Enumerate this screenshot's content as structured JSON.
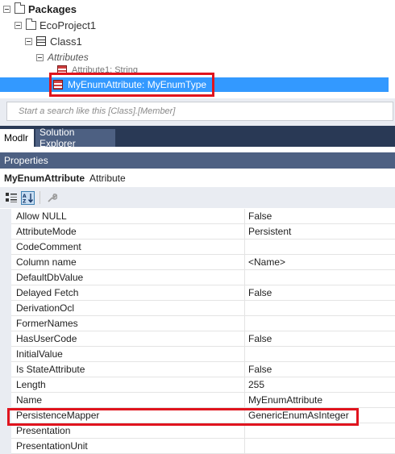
{
  "tree": {
    "root_label": "Packages",
    "project_label": "EcoProject1",
    "class_label": "Class1",
    "attributes_label": "Attributes",
    "attr1_label": "Attribute1: String",
    "selected_label": "MyEnumAttribute: MyEnumType"
  },
  "search": {
    "placeholder": "Start a search like this [Class].[Member]"
  },
  "tabs": [
    {
      "label": "Modlr",
      "active": true
    },
    {
      "label": "Solution Explorer",
      "active": false
    }
  ],
  "properties": {
    "header": "Properties",
    "object_name": "MyEnumAttribute",
    "object_type": "Attribute",
    "rows": [
      {
        "name": "Allow NULL",
        "value": "False"
      },
      {
        "name": "AttributeMode",
        "value": "Persistent"
      },
      {
        "name": "CodeComment",
        "value": ""
      },
      {
        "name": "Column name",
        "value": "<Name>"
      },
      {
        "name": "DefaultDbValue",
        "value": ""
      },
      {
        "name": "Delayed Fetch",
        "value": "False"
      },
      {
        "name": "DerivationOcl",
        "value": ""
      },
      {
        "name": "FormerNames",
        "value": ""
      },
      {
        "name": "HasUserCode",
        "value": "False"
      },
      {
        "name": "InitialValue",
        "value": ""
      },
      {
        "name": "Is StateAttribute",
        "value": "False"
      },
      {
        "name": "Length",
        "value": "255"
      },
      {
        "name": "Name",
        "value": "MyEnumAttribute"
      },
      {
        "name": "PersistenceMapper",
        "value": "GenericEnumAsInteger"
      },
      {
        "name": "Presentation",
        "value": ""
      },
      {
        "name": "PresentationUnit",
        "value": ""
      }
    ]
  },
  "colors": {
    "tab_bar": "#293955",
    "header": "#4d6082",
    "selection": "#3399ff",
    "highlight_box": "#e0141e"
  }
}
